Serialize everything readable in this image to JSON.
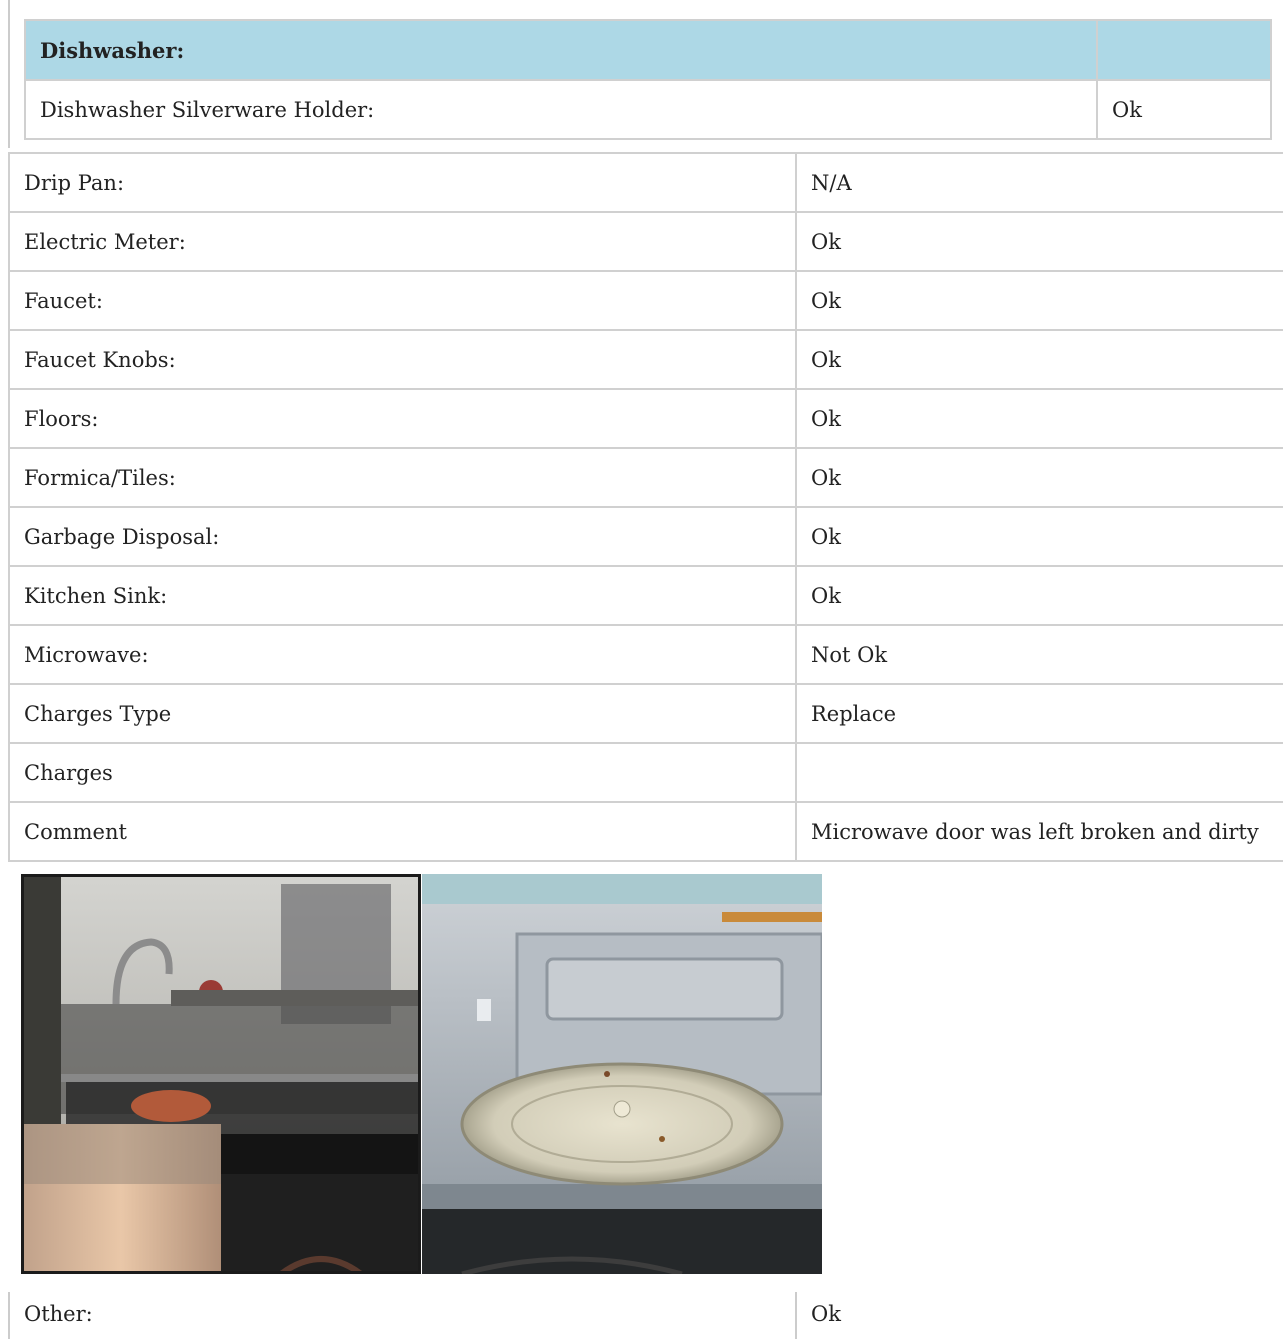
{
  "dishwasher": {
    "heading": "Dishwasher:",
    "rows": [
      {
        "label": "Dishwasher Silverware Holder:",
        "value": "Ok"
      }
    ]
  },
  "items": [
    {
      "label": "Drip Pan:",
      "value": "N/A"
    },
    {
      "label": "Electric Meter:",
      "value": "Ok"
    },
    {
      "label": "Faucet:",
      "value": "Ok"
    },
    {
      "label": "Faucet Knobs:",
      "value": "Ok"
    },
    {
      "label": "Floors:",
      "value": "Ok"
    },
    {
      "label": "Formica/Tiles:",
      "value": "Ok"
    },
    {
      "label": "Garbage Disposal:",
      "value": "Ok"
    },
    {
      "label": "Kitchen Sink:",
      "value": "Ok"
    },
    {
      "label": "Microwave:",
      "value": "Not Ok"
    },
    {
      "label": "Charges Type",
      "value": "Replace"
    },
    {
      "label": "Charges",
      "value": ""
    },
    {
      "label": "Comment",
      "value": "Microwave door was left broken and dirty"
    }
  ],
  "other": {
    "label": "Other:",
    "value": "Ok"
  },
  "colors": {
    "header_bg": "#add8e6",
    "border": "#d0d0d0"
  }
}
